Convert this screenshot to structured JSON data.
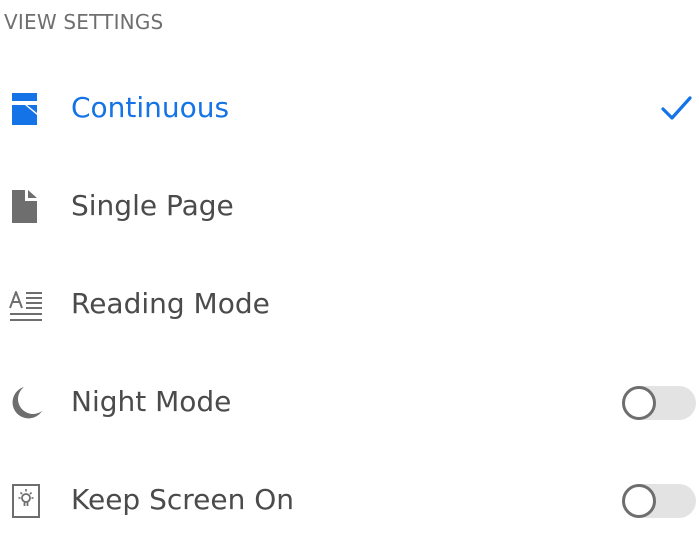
{
  "colors": {
    "accent": "#1473e6",
    "text": "#4b4b4b",
    "header": "#6f6f6f",
    "icon": "#6e6e6e",
    "toggle_track_off": "#e3e3e3"
  },
  "header": {
    "title": "VIEW SETTINGS"
  },
  "items": [
    {
      "label": "Continuous",
      "icon": "continuous-scroll-icon",
      "selected": true
    },
    {
      "label": "Single Page",
      "icon": "single-page-icon",
      "selected": false
    },
    {
      "label": "Reading Mode",
      "icon": "reading-mode-icon",
      "selected": false
    },
    {
      "label": "Night Mode",
      "icon": "moon-icon",
      "toggle": true,
      "toggle_on": false
    },
    {
      "label": "Keep Screen On",
      "icon": "lightbulb-screen-icon",
      "toggle": true,
      "toggle_on": false
    }
  ]
}
